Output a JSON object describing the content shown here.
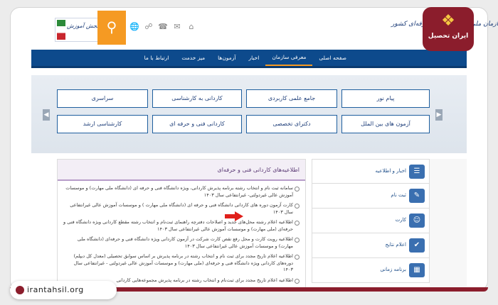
{
  "header": {
    "brand_text": "سایت سنجش آموزش",
    "org_title": "سازمان ملی آموزش فنی و حرفه‌ای کشور",
    "search_icon": "search-icon",
    "top_icons": [
      "globe-icon",
      "share-icon",
      "phone-icon",
      "mail-icon",
      "home-icon"
    ]
  },
  "nav": {
    "items": [
      "صفحه اصلی",
      "معرفی سازمان",
      "اخبار",
      "آزمون‌ها",
      "میز خدمت",
      "ارتباط با ما"
    ],
    "active_index": 1
  },
  "hero": {
    "buttons_row1": [
      "پیام نور",
      "جامع علمی کاربردی",
      "کاردانی به کارشناسی",
      "سراسری"
    ],
    "buttons_row2": [
      "آزمون های بین الملل",
      "دکترای تخصصی",
      "کاردانی فنی و حرفه ای",
      "کارشناسی ارشد"
    ],
    "prev_arrow": "chevron-left-icon",
    "next_arrow": "chevron-right-icon"
  },
  "news": {
    "title": "اطلاعیه‌های کاردانی فنی و حرفه‌ای",
    "items": [
      "سامانه ثبت نام و انتخاب رشته برنامه پذیرش کاردانی، ویژه دانشگاه فنی و حرفه ای (دانشگاه ملی مهارت) و موسسات آموزش عالی غیردولتی- غیرانتفاعی سال ۱۴۰۳",
      "کارت آزمون دوره های کاردانی دانشگاه فنی و حرفه ای (دانشگاه ملی مهارت ) و موسسات آموزش عالی غیرانتفاعی سال ۱۴۰۳",
      "اطلاعیه اعلام رشته محل‌های جدید و اصلاحات دفترچه راهنمای ثبت‌نام و انتخاب رشته مقطع کاردانی ویژه دانشگاه فنی و حرفه‌ای (ملی مهارت) و موسسات آموزش عالی غیرانتفاعی سال ۱۴۰۳",
      "اطلاعیه رویت کارت و محل رفع نقص کارت شرکت در آزمون کاردانی ویژه دانشگاه فنی و حرفه‌ای (دانشگاه ملی مهارت) و موسسات آموزش عالی غیرانتفاعی سال ۱۴۰۳",
      "اطلاعیه اعلام تاریخ مجدد برای ثبت نام و انتخاب رشته در برنامه پذیرش بر اساس سوابق تحصیلی (معدل کل دیپلم) دوره‌های کاردانی ویژه دانشگاه فنی و حرفه‌ای (ملی مهارت) و موسسات آموزش عالی غیردولتی - غیرانتفاعی سال ۱۴۰۳",
      "اطلاعیه اعلام تاریخ مجدد برای ثبت‌نام و انتخاب رشته در برنامه پذیرش مجموعه‌هایی کاردانی"
    ]
  },
  "sidebar": {
    "items": [
      {
        "label": "اخبار و اطلاعیه",
        "icon": "news-icon"
      },
      {
        "label": "ثبت نام",
        "icon": "register-icon"
      },
      {
        "label": "کارت",
        "icon": "id-card-icon"
      },
      {
        "label": "اعلام نتایج",
        "icon": "results-icon"
      },
      {
        "label": "برنامه زمانی",
        "icon": "calendar-icon"
      }
    ]
  },
  "watermark": {
    "logo_name": "ایران تحصیل",
    "site_url": "irantahsil.org"
  },
  "colors": {
    "nav": "#0d4a8c",
    "accent": "#f59a23",
    "watermark": "#8b1d2c"
  }
}
